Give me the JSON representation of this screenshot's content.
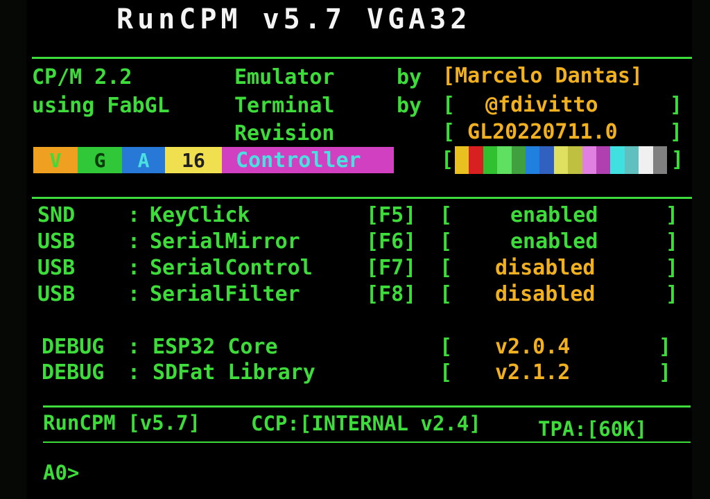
{
  "header": {
    "title": "RunCPM v5.7 VGA32"
  },
  "info": {
    "row1": {
      "left": "CP/M 2.2",
      "mid": "Emulator",
      "by": "by",
      "right": "[Marcelo Dantas]"
    },
    "row2": {
      "left": "using FabGL",
      "mid": "Terminal",
      "by": "by",
      "right_open": "[",
      "right_value": "@fdivitto",
      "right_close": "]"
    },
    "row3": {
      "mid": "Revision",
      "right_open": "[",
      "right_value": "GL20220711.0",
      "right_close": "]"
    },
    "vga": {
      "segments": [
        {
          "text": "V",
          "bg": "#f0a020",
          "fg": "#3ddc3a"
        },
        {
          "text": "G",
          "bg": "#30c838",
          "fg": "#0a3a0a"
        },
        {
          "text": "A",
          "bg": "#2878d8",
          "fg": "#4ae0e0"
        },
        {
          "text": "16",
          "bg": "#f0e050",
          "fg": "#202020"
        },
        {
          "text": "Controller",
          "bg": "#d040c0",
          "fg": "#4ae0e0"
        }
      ],
      "palette_open": "[",
      "palette_close": "]",
      "palette_colors": [
        "#e8c020",
        "#d82020",
        "#30c030",
        "#60e060",
        "#40a040",
        "#2080e0",
        "#3060c0",
        "#e0e060",
        "#c0c040",
        "#e080e0",
        "#b040b0",
        "#40e0e0",
        "#60c0c0",
        "#f0f0f0",
        "#808080"
      ]
    }
  },
  "settings": [
    {
      "device": "SND",
      "sep": ":",
      "name": "KeyClick",
      "key": "[F5]",
      "open": "[",
      "status": "enabled",
      "close": "]",
      "status_color": "#3ddc3a"
    },
    {
      "device": "USB",
      "sep": ":",
      "name": "SerialMirror",
      "key": "[F6]",
      "open": "[",
      "status": "enabled",
      "close": "]",
      "status_color": "#3ddc3a"
    },
    {
      "device": "USB",
      "sep": ":",
      "name": "SerialControl",
      "key": "[F7]",
      "open": "[",
      "status": "disabled",
      "close": "]",
      "status_color": "#f0b020"
    },
    {
      "device": "USB",
      "sep": ":",
      "name": "SerialFilter",
      "key": "[F8]",
      "open": "[",
      "status": "disabled",
      "close": "]",
      "status_color": "#f0b020"
    }
  ],
  "debug": [
    {
      "label": "DEBUG",
      "sep": ":",
      "name": "ESP32 Core",
      "open": "[",
      "version": "v2.0.4",
      "close": "]"
    },
    {
      "label": "DEBUG",
      "sep": ":",
      "name": "SDFat Library",
      "open": "[",
      "version": "v2.1.2",
      "close": "]"
    }
  ],
  "status_bar": {
    "runcpm": "RunCPM [v5.7]",
    "ccp": "CCP:[INTERNAL v2.4]",
    "tpa": "TPA:[60K]"
  },
  "prompt": {
    "text": "A0>"
  }
}
